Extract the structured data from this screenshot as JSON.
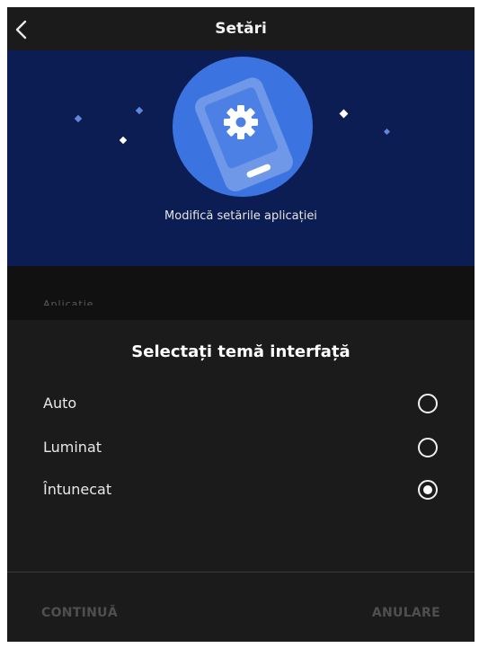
{
  "header": {
    "title": "Setări",
    "back_icon": "chevron-left-icon"
  },
  "hero": {
    "illustration": "settings-phone-illustration",
    "caption": "Modifică setările aplicației",
    "colors": {
      "background": "#0b1d52",
      "circle": "#3b74e0",
      "phone": "#6f98e8"
    }
  },
  "section": {
    "label": "Aplicație"
  },
  "dialog": {
    "title": "Selectați temă interfață",
    "options": [
      {
        "label": "Auto",
        "selected": false
      },
      {
        "label": "Luminat",
        "selected": false
      },
      {
        "label": "Întunecat",
        "selected": true
      }
    ],
    "continue_label": "CONTINUĂ",
    "cancel_label": "ANULARE"
  }
}
